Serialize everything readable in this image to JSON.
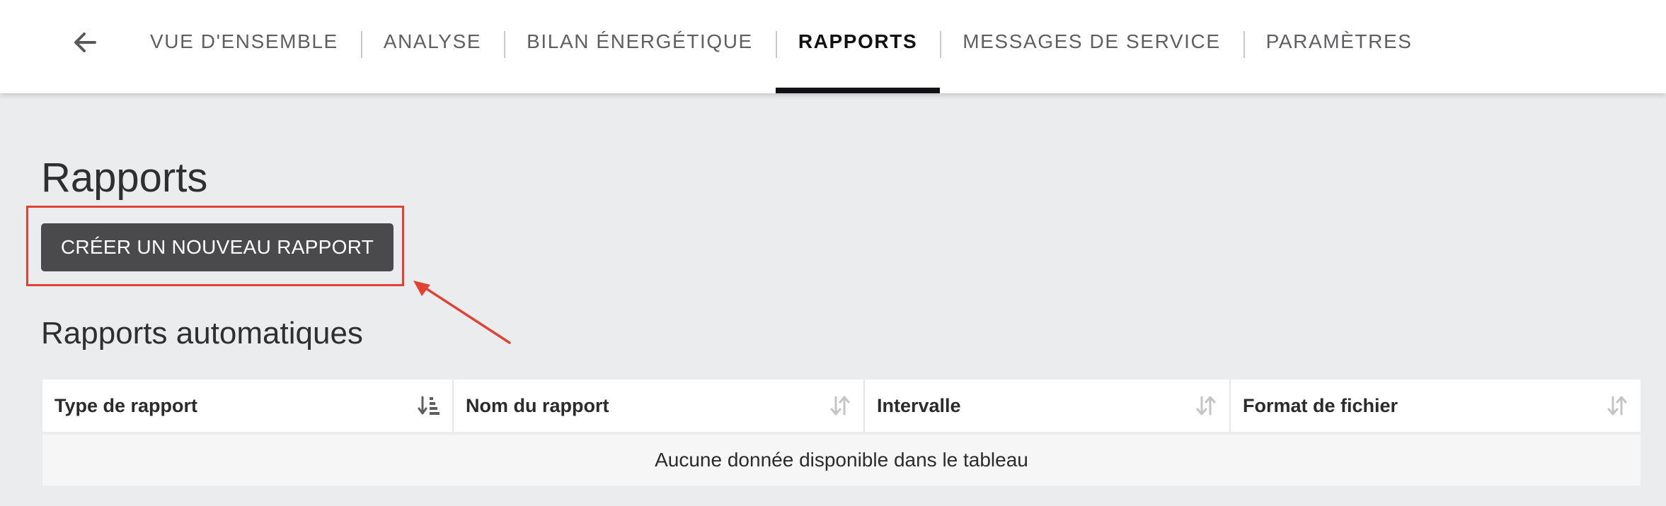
{
  "nav": {
    "back_icon": "arrow-left-icon",
    "tabs": [
      {
        "label": "VUE D'ENSEMBLE",
        "active": false
      },
      {
        "label": "ANALYSE",
        "active": false
      },
      {
        "label": "BILAN ÉNERGÉTIQUE",
        "active": false
      },
      {
        "label": "RAPPORTS",
        "active": true
      },
      {
        "label": "MESSAGES DE SERVICE",
        "active": false
      },
      {
        "label": "PARAMÈTRES",
        "active": false
      }
    ]
  },
  "main": {
    "title": "Rapports",
    "create_button_label": "CRÉER UN NOUVEAU RAPPORT",
    "section_title": "Rapports automatiques"
  },
  "table": {
    "columns": [
      {
        "label": "Type de rapport",
        "sort_icon": "sort-amount-down-icon",
        "sorted": true
      },
      {
        "label": "Nom du rapport",
        "sort_icon": "sort-icon",
        "sorted": false
      },
      {
        "label": "Intervalle",
        "sort_icon": "sort-icon",
        "sorted": false
      },
      {
        "label": "Format de fichier",
        "sort_icon": "sort-icon",
        "sorted": false
      }
    ],
    "empty_message": "Aucune donnée disponible dans le tableau"
  },
  "colors": {
    "annotation": "#e04233",
    "button_bg": "#4a4a4c",
    "page_bg": "#ebeced",
    "active_tab_underline": "#111111"
  }
}
